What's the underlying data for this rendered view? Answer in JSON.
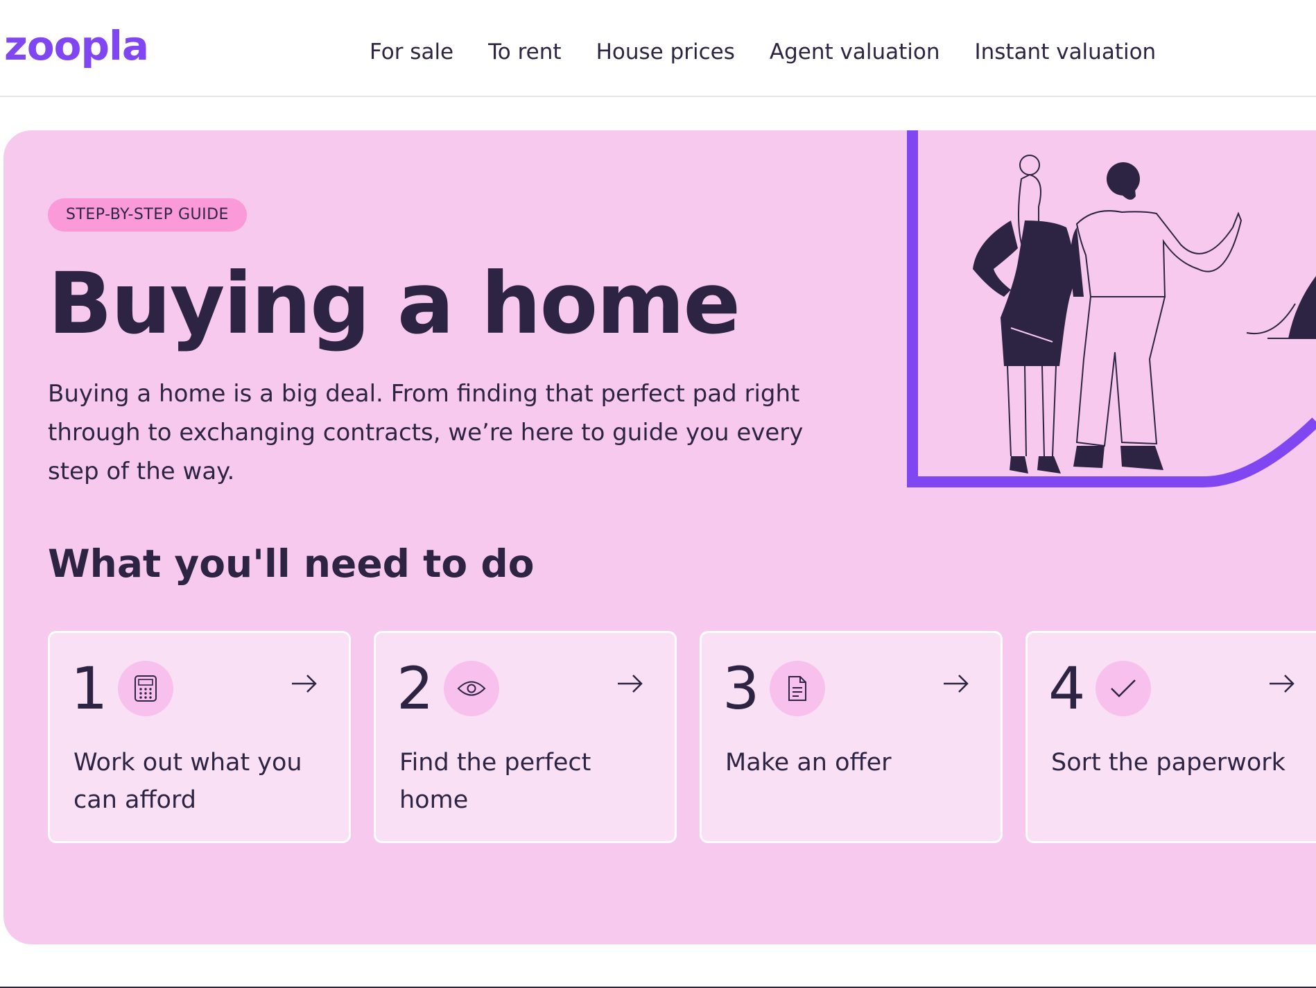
{
  "header": {
    "logo": "zoopla",
    "nav": [
      {
        "label": "For sale"
      },
      {
        "label": "To rent"
      },
      {
        "label": "House prices"
      },
      {
        "label": "Agent valuation"
      },
      {
        "label": "Instant valuation"
      }
    ]
  },
  "hero": {
    "badge": "STEP-BY-STEP GUIDE",
    "title": "Buying a home",
    "intro": "Buying a home is a big deal. From finding that perfect pad right through to exchanging contracts, we’re here to guide you every step of the way.",
    "subtitle": "What you'll need to do"
  },
  "steps": [
    {
      "number": "1",
      "icon": "calculator-icon",
      "label": "Work out what you can afford"
    },
    {
      "number": "2",
      "icon": "eye-icon",
      "label": "Find the perfect home"
    },
    {
      "number": "3",
      "icon": "document-icon",
      "label": "Make an offer"
    },
    {
      "number": "4",
      "icon": "checkmark-icon",
      "label": "Sort the paperwork"
    }
  ],
  "colors": {
    "brand": "#8046f1",
    "hero_background": "#f8c9ef",
    "badge_background": "#fb9ad8",
    "card_background": "#f9e0f5",
    "text": "#2c2442"
  }
}
